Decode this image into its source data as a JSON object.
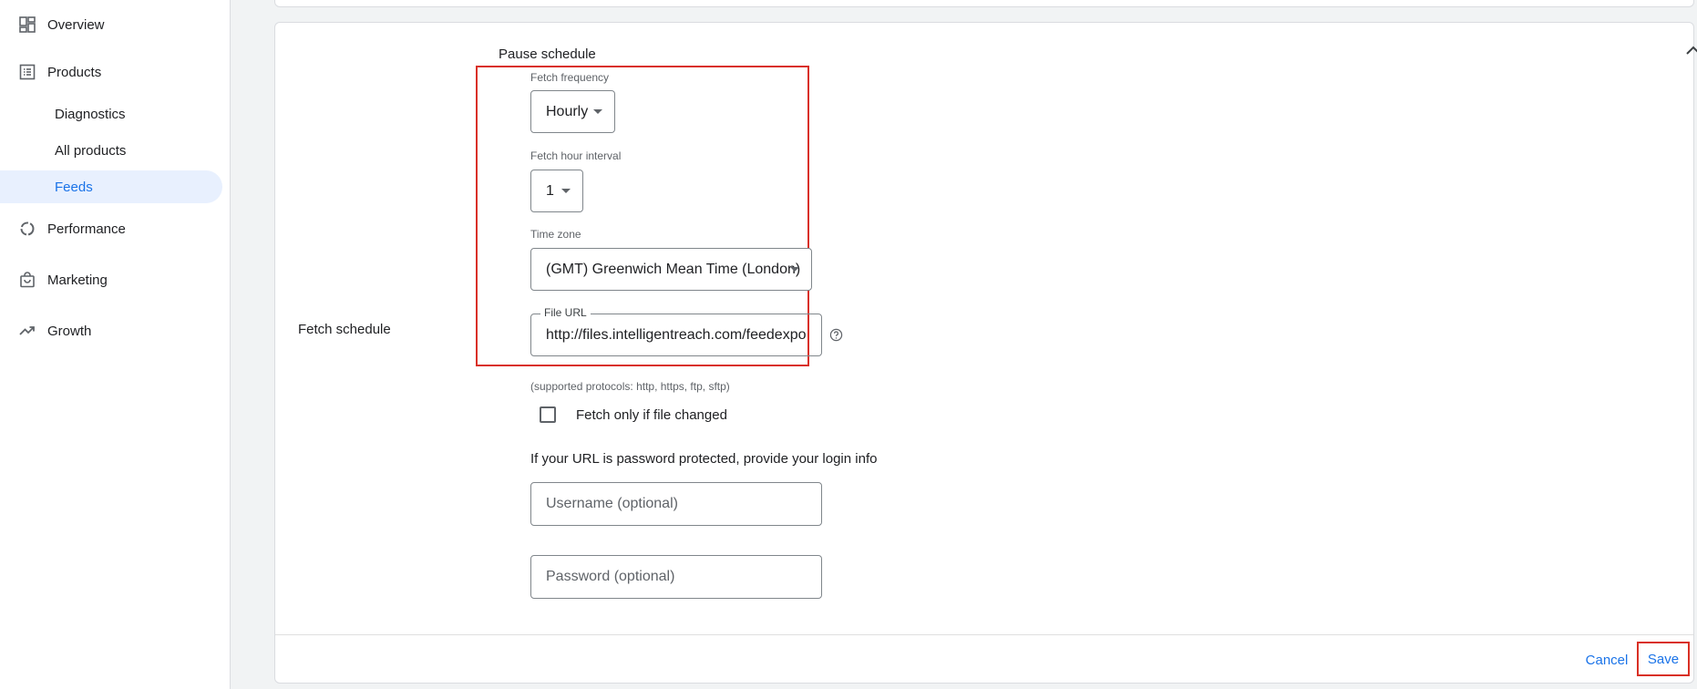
{
  "sidebar": {
    "items": [
      {
        "label": "Overview",
        "icon": "dashboard-icon"
      },
      {
        "label": "Products",
        "icon": "list-icon"
      },
      {
        "label": "Diagnostics"
      },
      {
        "label": "All products"
      },
      {
        "label": "Feeds"
      },
      {
        "label": "Performance",
        "icon": "donut-chart-icon"
      },
      {
        "label": "Marketing",
        "icon": "shopping-bag-icon"
      },
      {
        "label": "Growth",
        "icon": "trending-up-icon"
      }
    ],
    "active_item": "Feeds"
  },
  "form": {
    "section_label": "Fetch schedule",
    "pause_label": "Pause schedule",
    "fetch_frequency": {
      "label": "Fetch frequency",
      "value": "Hourly"
    },
    "fetch_hour_interval": {
      "label": "Fetch hour interval",
      "value": "1"
    },
    "time_zone": {
      "label": "Time zone",
      "value": "(GMT) Greenwich Mean Time (London)"
    },
    "file_url": {
      "label": "File URL",
      "value": "http://files.intelligentreach.com/feedexport"
    },
    "protocols_hint": "(supported protocols: http, https, ftp, sftp)",
    "fetch_changed": {
      "label": "Fetch only if file changed",
      "checked": false
    },
    "login_info": "If your URL is password protected, provide your login info",
    "username_placeholder": "Username (optional)",
    "password_placeholder": "Password (optional)"
  },
  "footer": {
    "cancel_label": "Cancel",
    "save_label": "Save"
  },
  "colors": {
    "accent": "#1a73e8",
    "highlight": "#d93025",
    "active_bg": "#e8f0fe"
  }
}
